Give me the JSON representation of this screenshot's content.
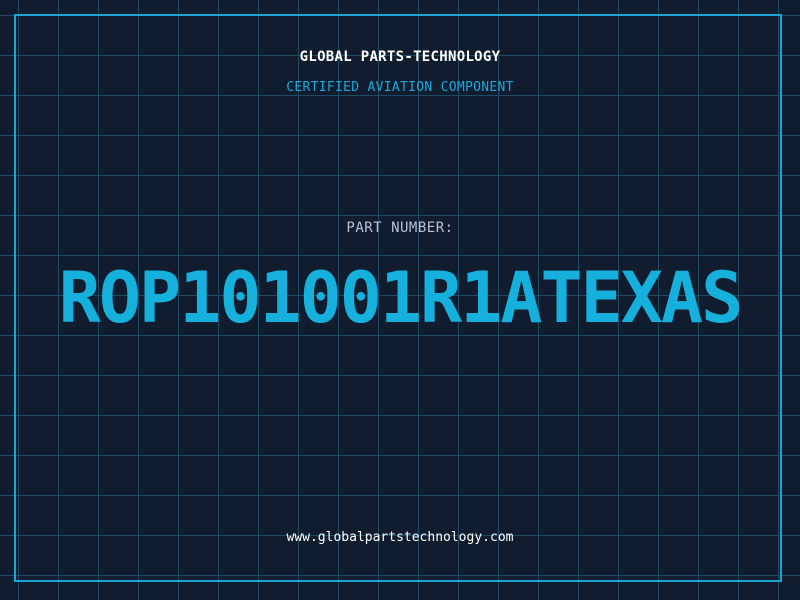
{
  "header": {
    "company": "GLOBAL PARTS-TECHNOLOGY",
    "subtitle": "CERTIFIED AVIATION COMPONENT"
  },
  "part": {
    "label": "PART NUMBER:",
    "number": "ROP101001R1ATEXAS"
  },
  "footer": {
    "website": "www.globalpartstechnology.com"
  },
  "colors": {
    "background": "#111c2f",
    "grid": "#1f4a63",
    "accent": "#16b0dc",
    "text": "#ffffff"
  }
}
